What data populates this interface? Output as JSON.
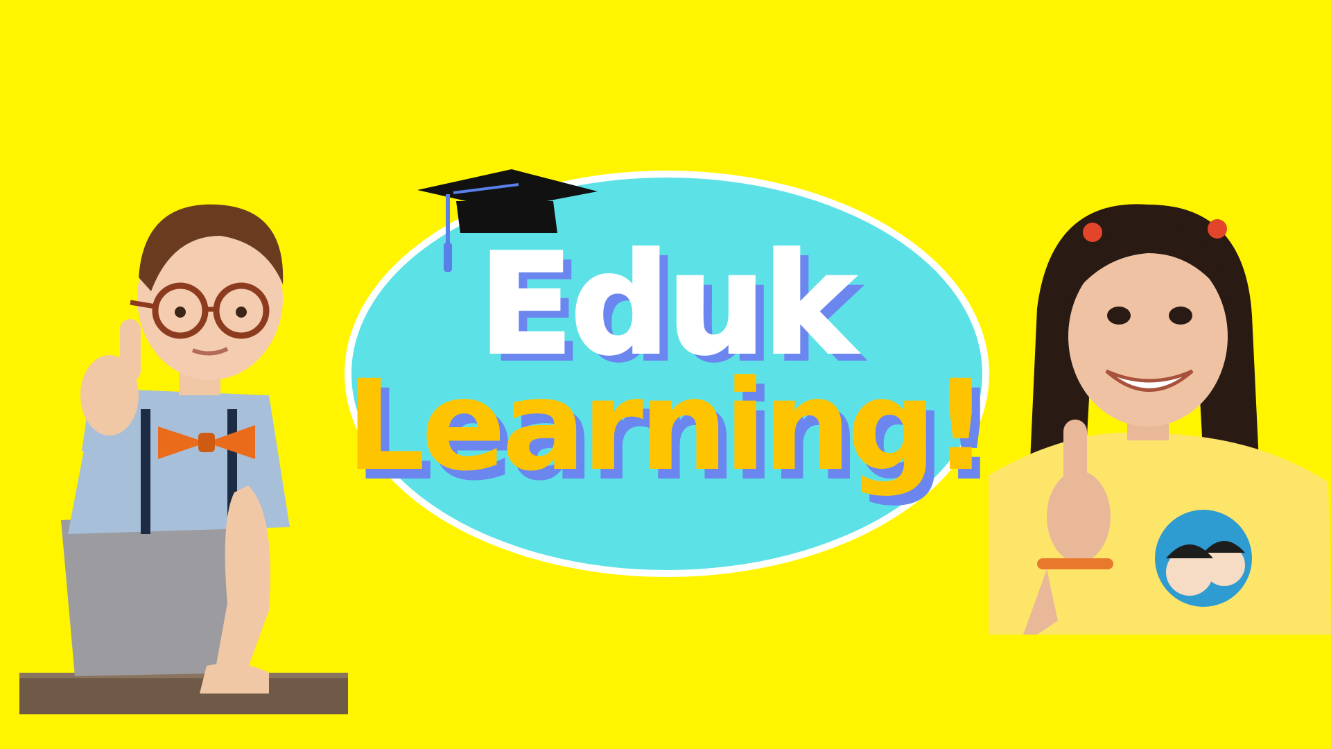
{
  "banner": {
    "title_line_1": "Eduk",
    "title_line_2": "Learning!"
  },
  "icons": {
    "cap": "graduation-cap-icon",
    "left_photo": "boy-thumbs-up",
    "right_photo": "girl-thumbs-up"
  },
  "colors": {
    "background": "#fff500",
    "oval_fill": "#5ce2e6",
    "oval_border": "#ffffff",
    "title_line_1": "#ffffff",
    "title_line_2": "#ffc400",
    "title_shadow": "#6b86ee",
    "cap": "#111111",
    "tassel": "#5b7fe8"
  }
}
